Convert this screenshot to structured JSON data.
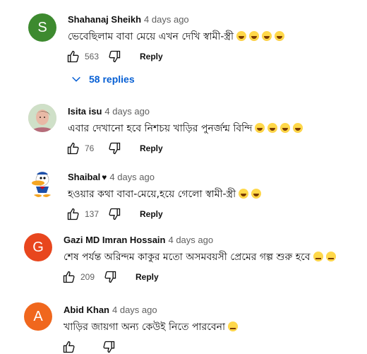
{
  "comments": [
    {
      "author": "Shahanaj Sheikh",
      "time": "4 days ago",
      "text": "ভেবেছিলাম বাবা মেয়ে এখন দেখি স্বামী-স্ত্রী",
      "likes": "563",
      "reply_label": "Reply",
      "avatar_letter": "S",
      "avatar_color": "#3d8a2f",
      "emoji_count": 4
    },
    {
      "author": "Isita isu",
      "time": "4 days ago",
      "text": "এবার দেখানো হবে নিশচয় খাড়ির পুনর্জন্ম বিন্দি",
      "likes": "76",
      "reply_label": "Reply",
      "emoji_count": 4
    },
    {
      "author": "Shaibal",
      "time": "4 days ago",
      "text": "হওয়ার কথা বাবা-মেয়ে,হয়ে গেলো স্বামী-স্ত্রী",
      "likes": "137",
      "reply_label": "Reply",
      "emoji_count": 2
    },
    {
      "author": "Gazi MD Imran Hossain",
      "time": "4 days ago",
      "text": "শেষ পর্যন্ত অরিন্দম কাকুর মতো অসমবয়সী প্রেমের গল্প শুরু হবে",
      "likes": "209",
      "reply_label": "Reply",
      "avatar_letter": "G",
      "avatar_color": "#e8461e",
      "emoji_count": 2
    },
    {
      "author": "Abid Khan",
      "time": "4 days ago",
      "text": "খাড়ির জায়গা অন্য কেউই নিতে পারবেনা",
      "avatar_letter": "A",
      "avatar_color": "#f0671d",
      "emoji_count": 1
    }
  ],
  "replies_toggle": "58 replies",
  "colors": {
    "link": "#065fd4",
    "meta": "#606060"
  },
  "icons": [
    "thumb-up-icon",
    "thumb-down-icon",
    "chevron-down-icon",
    "heart-icon"
  ]
}
